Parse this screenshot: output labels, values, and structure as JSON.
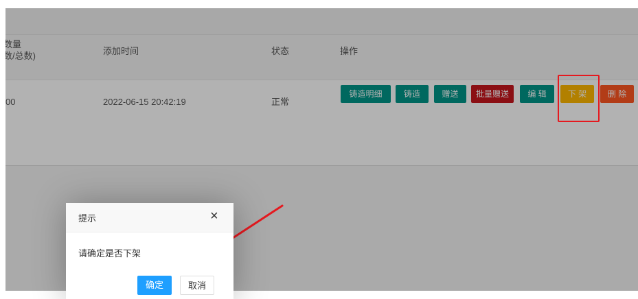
{
  "table": {
    "headers": {
      "quantity_line1": "数量",
      "quantity_line2": "数/总数)",
      "added_time": "添加时间",
      "status": "状态",
      "actions": "操作"
    },
    "row": {
      "quantity": "00",
      "added_time": "2022-06-15 20:42:19",
      "status": "正常"
    },
    "actions": {
      "cast_detail": "铸造明细",
      "cast": "铸造",
      "gift": "赠送",
      "batch_gift": "批量赠送",
      "edit": "编 辑",
      "unlist": "下 架",
      "delete": "删 除"
    }
  },
  "dialog": {
    "title": "提示",
    "close_glyph": "×",
    "message": "请确定是否下架",
    "confirm": "确定",
    "cancel": "取消"
  },
  "colors": {
    "green": "#009688",
    "red": "#c8161e",
    "yellow": "#ffb800",
    "orange": "#ff5722",
    "confirm_blue": "#1e9fff",
    "annotation_red": "#e5191f"
  }
}
